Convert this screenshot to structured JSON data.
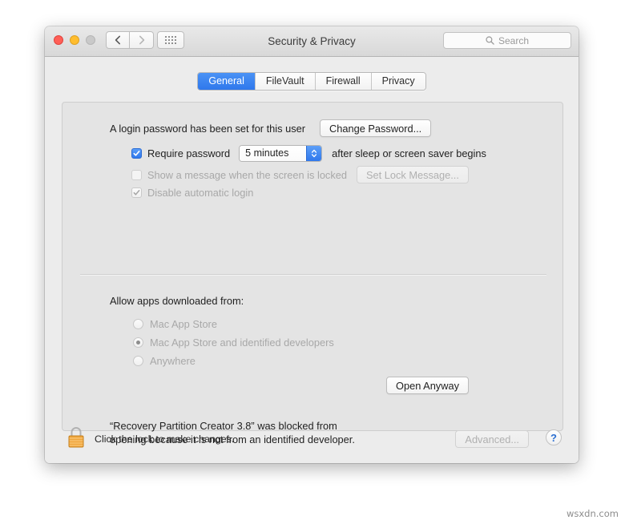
{
  "window": {
    "title": "Security & Privacy",
    "traffic_lights": {
      "close": "close-button",
      "minimize": "minimize-button",
      "zoom": "zoom-button"
    },
    "nav": {
      "back": "back-icon",
      "forward": "forward-icon",
      "show_all": "grid-icon"
    },
    "search": {
      "placeholder": "Search",
      "icon": "search-icon"
    }
  },
  "tabs": [
    {
      "label": "General",
      "active": true
    },
    {
      "label": "FileVault",
      "active": false
    },
    {
      "label": "Firewall",
      "active": false
    },
    {
      "label": "Privacy",
      "active": false
    }
  ],
  "general": {
    "password_status": "A login password has been set for this user",
    "change_password_button": "Change Password...",
    "require_password": {
      "label": "Require password",
      "checked": true,
      "interval": "5 minutes",
      "suffix": "after sleep or screen saver begins"
    },
    "show_message": {
      "label": "Show a message when the screen is locked",
      "checked": false,
      "button": "Set Lock Message...",
      "enabled": false
    },
    "disable_auto_login": {
      "label": "Disable automatic login",
      "checked": true,
      "enabled": false
    }
  },
  "gatekeeper": {
    "heading": "Allow apps downloaded from:",
    "options": [
      {
        "label": "Mac App Store",
        "selected": false
      },
      {
        "label": "Mac App Store and identified developers",
        "selected": true
      },
      {
        "label": "Anywhere",
        "selected": false
      }
    ],
    "blocked_message_line1": "“Recovery Partition Creator 3.8” was blocked from",
    "blocked_message_line2": "opening because it is not from an identified developer.",
    "open_anyway_button": "Open Anyway"
  },
  "bottom": {
    "lock_icon": "padlock-closed-icon",
    "lock_text": "Click the lock to make changes.",
    "advanced_button": "Advanced...",
    "help_button": "?"
  },
  "watermark": "wsxdn.com",
  "colors": {
    "accent_blue": "#2f78ec",
    "lock_gold": "#f0a63c",
    "help_blue": "#2c6fd1"
  }
}
